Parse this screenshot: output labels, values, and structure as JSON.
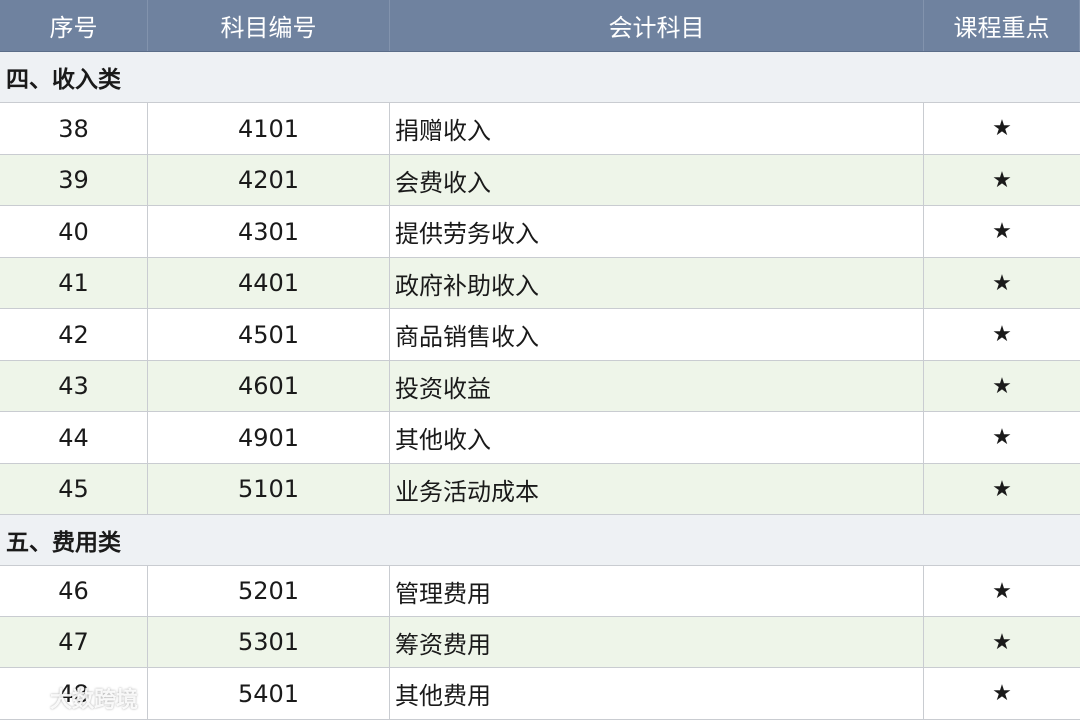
{
  "header": {
    "col1": "序号",
    "col2": "科目编号",
    "col3": "会计科目",
    "col4": "课程重点"
  },
  "sections": [
    {
      "title": "四、收入类",
      "rows": [
        {
          "no": "38",
          "code": "4101",
          "name": "捐赠收入",
          "key": "★"
        },
        {
          "no": "39",
          "code": "4201",
          "name": "会费收入",
          "key": "★"
        },
        {
          "no": "40",
          "code": "4301",
          "name": "提供劳务收入",
          "key": "★"
        },
        {
          "no": "41",
          "code": "4401",
          "name": "政府补助收入",
          "key": "★"
        },
        {
          "no": "42",
          "code": "4501",
          "name": "商品销售收入",
          "key": "★"
        },
        {
          "no": "43",
          "code": "4601",
          "name": "投资收益",
          "key": "★"
        },
        {
          "no": "44",
          "code": "4901",
          "name": "其他收入",
          "key": "★"
        },
        {
          "no": "45",
          "code": "5101",
          "name": "业务活动成本",
          "key": "★"
        }
      ]
    },
    {
      "title": "五、费用类",
      "rows": [
        {
          "no": "46",
          "code": "5201",
          "name": "管理费用",
          "key": "★"
        },
        {
          "no": "47",
          "code": "5301",
          "name": "筹资费用",
          "key": "★"
        },
        {
          "no": "48",
          "code": "5401",
          "name": "其他费用",
          "key": "★"
        }
      ]
    }
  ],
  "watermark": {
    "text": "大数跨境",
    "icon": "wechat-logo-icon"
  }
}
